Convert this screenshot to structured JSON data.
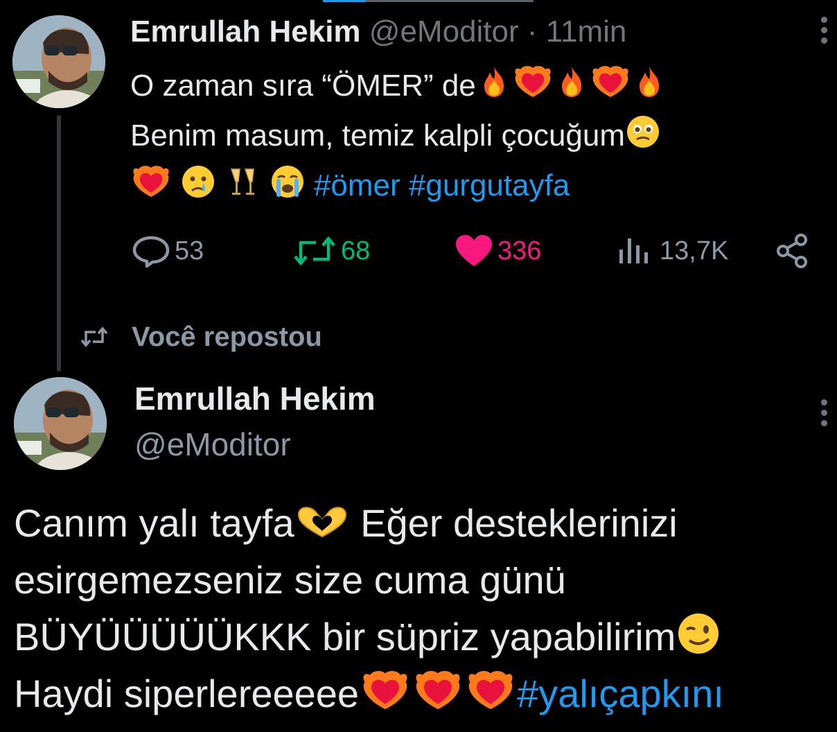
{
  "tweet1": {
    "author_name": "Emrullah Hekim",
    "handle": "@eModitor",
    "time": "· 11min",
    "line1": "O zaman sıra “ÖMER” de",
    "line2": "Benim masum, temiz kalpli çocuğum",
    "hashtags": "#ömer #gurgutayfa",
    "stats": {
      "replies": "53",
      "retweets": "68",
      "likes": "336",
      "views": "13,7K"
    }
  },
  "repost": {
    "label": "Você repostou"
  },
  "tweet2": {
    "author_name": "Emrullah Hekim",
    "handle": "@eModitor",
    "line1": "Canım yalı tayfa",
    "line1b": " Eğer desteklerinizi",
    "line2": "esirgemezseniz size cuma günü",
    "line3": "BÜYÜÜÜÜÜKKK bir süpriz yapabilirim",
    "line4": "Haydi siperlereeeee",
    "hashtag": "#yalıçapkını"
  },
  "colors": {
    "background": "#000000",
    "text": "#e7e9ea",
    "muted": "#71767b",
    "hashtag": "#1d9bf0",
    "retweet": "#00ba7c",
    "like": "#f91880"
  },
  "icons": {
    "reply": "reply-icon",
    "retweet": "retweet-icon",
    "like": "heart-icon",
    "views": "views-icon",
    "share": "share-icon",
    "more": "more-icon"
  }
}
